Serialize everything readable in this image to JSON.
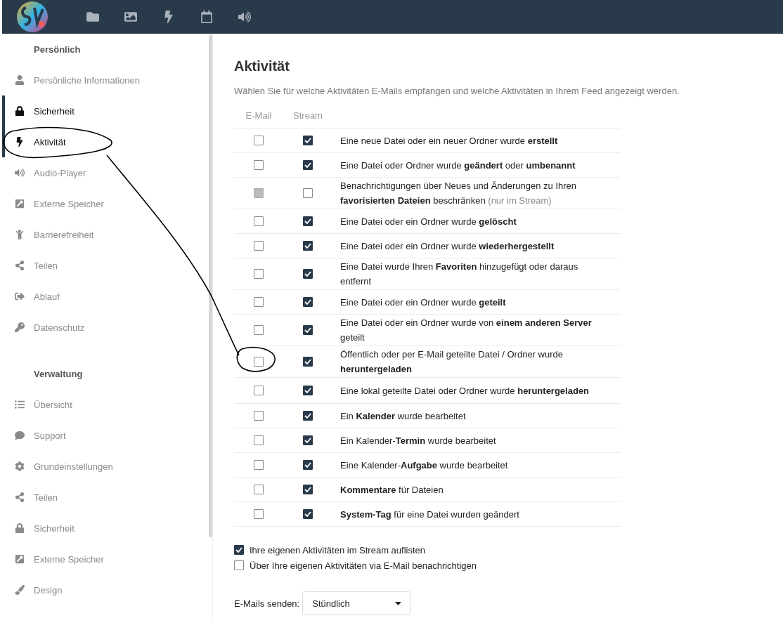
{
  "sidebar": {
    "sections": [
      {
        "heading": "Persönlich",
        "items": [
          {
            "label": "Persönliche Informationen",
            "selected": false
          },
          {
            "label": "Sicherheit",
            "selected": true
          },
          {
            "label": "Aktivität",
            "selected": true
          },
          {
            "label": "Audio-Player",
            "selected": false
          },
          {
            "label": "Externe Speicher",
            "selected": false
          },
          {
            "label": "Barrierefreiheit",
            "selected": false
          },
          {
            "label": "Teilen",
            "selected": false
          },
          {
            "label": "Ablauf",
            "selected": false
          },
          {
            "label": "Datenschutz",
            "selected": false
          }
        ]
      },
      {
        "heading": "Verwaltung",
        "items": [
          {
            "label": "Übersicht",
            "selected": false
          },
          {
            "label": "Support",
            "selected": false
          },
          {
            "label": "Grundeinstellungen",
            "selected": false
          },
          {
            "label": "Teilen",
            "selected": false
          },
          {
            "label": "Sicherheit",
            "selected": false
          },
          {
            "label": "Externe Speicher",
            "selected": false
          },
          {
            "label": "Design",
            "selected": false
          }
        ]
      }
    ]
  },
  "main": {
    "title": "Aktivität",
    "description": "Wählen Sie für welche Aktivitäten E-Mails empfangen und welche Aktivitäten in Ihrem Feed angezeigt werden.",
    "table": {
      "columns": [
        "E-Mail",
        "Stream"
      ],
      "rows": [
        {
          "text": "Eine neue Datei oder ein neuer Ordner wurde **erstellt**",
          "email": {
            "checked": false,
            "disabled": false
          },
          "stream": {
            "checked": true
          }
        },
        {
          "text": "Eine Datei oder Ordner wurde **geändert** oder **umbenannt**",
          "email": {
            "checked": false,
            "disabled": false
          },
          "stream": {
            "checked": true
          }
        },
        {
          "text": "Benachrichtigungen über Neues und Änderungen zu Ihren **favorisierten Dateien** beschränken",
          "note": "(nur im Stream)",
          "email": {
            "checked": false,
            "disabled": true
          },
          "stream": {
            "checked": false
          }
        },
        {
          "text": "Eine Datei oder ein Ordner wurde **gelöscht**",
          "email": {
            "checked": false,
            "disabled": false
          },
          "stream": {
            "checked": true
          }
        },
        {
          "text": "Eine Datei oder ein Ordner wurde **wiederhergestellt**",
          "email": {
            "checked": false,
            "disabled": false
          },
          "stream": {
            "checked": true
          }
        },
        {
          "text": "Eine Datei wurde Ihren **Favoriten** hinzugefügt oder daraus entfernt",
          "email": {
            "checked": false,
            "disabled": false
          },
          "stream": {
            "checked": true
          }
        },
        {
          "text": "Eine Datei oder ein Ordner wurde **geteilt**",
          "email": {
            "checked": false,
            "disabled": false
          },
          "stream": {
            "checked": true
          }
        },
        {
          "text": "Eine Datei oder ein Ordner wurde von **einem anderen Server** geteilt",
          "email": {
            "checked": false,
            "disabled": false
          },
          "stream": {
            "checked": true
          }
        },
        {
          "text": "Öffentlich oder per E-Mail geteilte Datei / Ordner wurde **heruntergeladen**",
          "email": {
            "checked": false,
            "disabled": false
          },
          "stream": {
            "checked": true
          }
        },
        {
          "text": "Eine lokal geteilte Datei oder Ordner wurde **heruntergeladen**",
          "email": {
            "checked": false,
            "disabled": false
          },
          "stream": {
            "checked": true
          }
        },
        {
          "text": "Ein **Kalender** wurde bearbeitet",
          "email": {
            "checked": false,
            "disabled": false
          },
          "stream": {
            "checked": true
          }
        },
        {
          "text": "Ein Kalender-**Termin** wurde bearbeitet",
          "email": {
            "checked": false,
            "disabled": false
          },
          "stream": {
            "checked": true
          }
        },
        {
          "text": "Eine Kalender-**Aufgabe** wurde bearbeitet",
          "email": {
            "checked": false,
            "disabled": false
          },
          "stream": {
            "checked": true
          }
        },
        {
          "text": "**Kommentare** für Dateien",
          "email": {
            "checked": false,
            "disabled": false
          },
          "stream": {
            "checked": true
          }
        },
        {
          "text": "**System-Tag** für eine Datei wurden geändert",
          "email": {
            "checked": false,
            "disabled": false
          },
          "stream": {
            "checked": true
          }
        }
      ]
    },
    "options": [
      {
        "label": "Ihre eigenen Aktivitäten im Stream auflisten",
        "checked": true
      },
      {
        "label": "Über Ihre eigenen Aktivitäten via E-Mail benachrichtigen",
        "checked": false
      }
    ],
    "send": {
      "label": "E-Mails senden:",
      "value": "Stündlich"
    }
  }
}
